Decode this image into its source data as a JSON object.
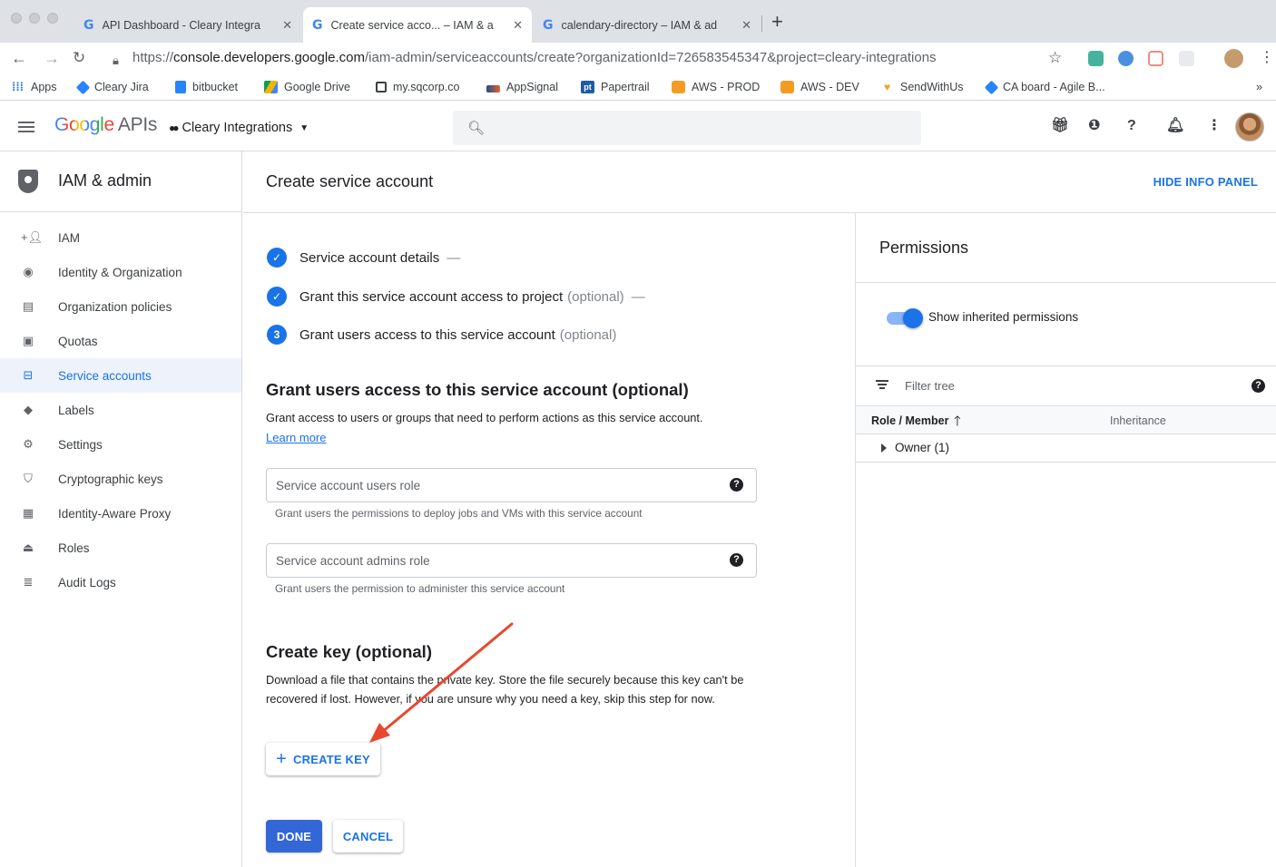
{
  "browser": {
    "tabs": [
      {
        "title": "API Dashboard - Cleary Integra",
        "active": false
      },
      {
        "title": "Create service acco... – IAM & a",
        "active": true
      },
      {
        "title": "calendary-directory – IAM & ad",
        "active": false
      }
    ],
    "url_prefix": "https://",
    "url_host": "console.developers.google.com",
    "url_path": "/iam-admin/serviceaccounts/create?organizationId=726583545347&project=cleary-integrations",
    "bookmarks": [
      "Apps",
      "Cleary Jira",
      "bitbucket",
      "Google Drive",
      "my.sqcorp.co",
      "AppSignal",
      "Papertrail",
      "AWS - PROD",
      "AWS - DEV",
      "SendWithUs",
      "CA board - Agile B..."
    ],
    "bookmarks_overflow": "»"
  },
  "header": {
    "logo_google": "Google",
    "logo_apis": "APIs",
    "project": "Cleary Integrations"
  },
  "sidebar": {
    "title": "IAM & admin",
    "items": [
      {
        "label": "IAM",
        "icon": "person-add-icon"
      },
      {
        "label": "Identity & Organization",
        "icon": "account-circle-icon"
      },
      {
        "label": "Organization policies",
        "icon": "policy-doc-icon"
      },
      {
        "label": "Quotas",
        "icon": "quota-icon"
      },
      {
        "label": "Service accounts",
        "icon": "service-account-icon",
        "active": true
      },
      {
        "label": "Labels",
        "icon": "label-icon"
      },
      {
        "label": "Settings",
        "icon": "settings-icon"
      },
      {
        "label": "Cryptographic keys",
        "icon": "key-shield-icon"
      },
      {
        "label": "Identity-Aware Proxy",
        "icon": "proxy-icon"
      },
      {
        "label": "Roles",
        "icon": "roles-icon"
      },
      {
        "label": "Audit Logs",
        "icon": "audit-logs-icon"
      }
    ]
  },
  "main": {
    "page_title": "Create service account",
    "hide_info_panel": "HIDE INFO PANEL",
    "steps": [
      {
        "label": "Service account details",
        "optional": "",
        "state": "done"
      },
      {
        "label": "Grant this service account access to project",
        "optional": "(optional)",
        "state": "done"
      },
      {
        "label": "Grant users access to this service account",
        "optional": "(optional)",
        "state": "current",
        "number": "3"
      }
    ],
    "grant_section": {
      "title": "Grant users access to this service account (optional)",
      "description": "Grant access to users or groups that need to perform actions as this service account.",
      "learn_more": "Learn more",
      "users_role_placeholder": "Service account users role",
      "users_role_hint": "Grant users the permissions to deploy jobs and VMs with this service account",
      "admins_role_placeholder": "Service account admins role",
      "admins_role_hint": "Grant users the permission to administer this service account"
    },
    "key_section": {
      "title": "Create key (optional)",
      "description": "Download a file that contains the private key. Store the file securely because this key can't be recovered if lost. However, if you are unsure why you need a key, skip this step for now.",
      "create_key": "CREATE KEY"
    },
    "done": "DONE",
    "cancel": "CANCEL"
  },
  "info_panel": {
    "title": "Permissions",
    "toggle_label": "Show inherited permissions",
    "toggle_on": true,
    "filter_placeholder": "Filter tree",
    "col_role_member": "Role / Member",
    "col_inheritance": "Inheritance",
    "tree_rows": [
      {
        "label": "Owner (1)"
      }
    ]
  },
  "colors": {
    "accent": "#1a73e8",
    "annotation_arrow": "#e8472f"
  }
}
